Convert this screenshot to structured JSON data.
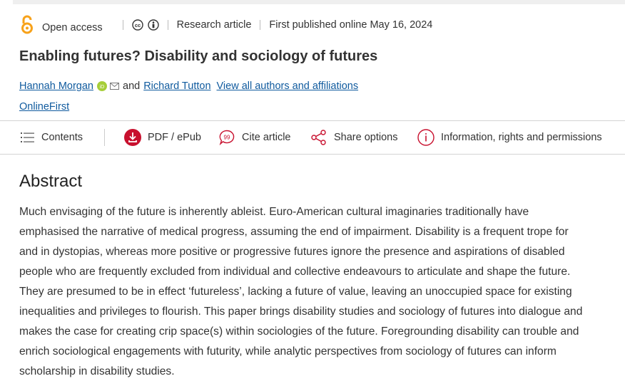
{
  "meta": {
    "open_access_label": "Open access",
    "article_type": "Research article",
    "published": "First published online May 16, 2024",
    "license_icons": [
      "creative-commons-icon",
      "attribution-icon"
    ]
  },
  "article": {
    "title": "Enabling futures? Disability and sociology of futures",
    "authors": [
      {
        "name": "Hannah Morgan"
      },
      {
        "name": "Richard Tutton"
      }
    ],
    "conjunction": "and",
    "view_all_link": "View all authors and affiliations",
    "online_first": "OnlineFirst"
  },
  "toolbar": {
    "contents": "Contents",
    "pdf": "PDF / ePub",
    "cite": "Cite article",
    "share": "Share options",
    "info": "Information, rights and permissions"
  },
  "abstract": {
    "heading": "Abstract",
    "text": "Much envisaging of the future is inherently ableist. Euro-American cultural imaginaries traditionally have emphasised the narrative of medical progress, assuming the end of impairment. Disability is a frequent trope for and in dystopias, whereas more positive or progressive futures ignore the presence and aspirations of disabled people who are frequently excluded from individual and collective endeavours to articulate and shape the future. They are presumed to be in effect ‘futureless’, lacking a future of value, leaving an unoccupied space for existing inequalities and privileges to flourish. This paper brings disability studies and sociology of futures into dialogue and makes the case for creating crip space(s) within sociologies of the future. Foregrounding disability can trouble and enrich sociological engagements with futurity, while analytic perspectives from sociology of futures can inform scholarship in disability studies."
  },
  "colors": {
    "accent_orange": "#f7a21b",
    "link_blue": "#0f5a9e",
    "toolbar_red": "#c8102e",
    "orcid_green": "#a6ce39"
  }
}
